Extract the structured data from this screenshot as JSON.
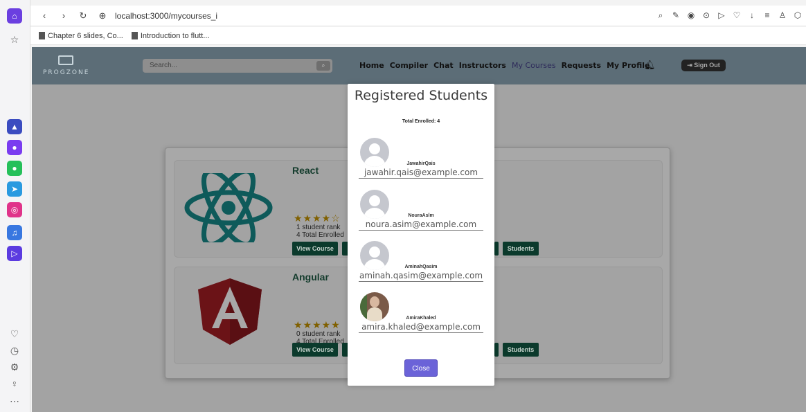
{
  "browser": {
    "url": "localhost:3000/mycourses_i",
    "bookmarks": [
      "Chapter 6 slides, Co...",
      "Introduction to flutt..."
    ]
  },
  "navbar": {
    "logo_text": "PROGZONE",
    "search_placeholder": "Search...",
    "links": [
      "Home",
      "Compiler",
      "Chat",
      "Instructors",
      "My Courses",
      "Requests",
      "My Profile"
    ],
    "active_link": "My Courses",
    "signout_label": "Sign Out"
  },
  "courses": [
    {
      "title": "React",
      "rating_stars": 4,
      "student_rank": "1 student rank",
      "enrolled": "4 Total Enrolled",
      "view_label": "View Course",
      "students_label": "Students"
    },
    {
      "title": "Angular",
      "rating_stars": 5,
      "student_rank": "0 student rank",
      "enrolled": "4 Total Enrolled",
      "view_label": "View Course",
      "students_label": "Students"
    }
  ],
  "modal": {
    "title": "Registered Students",
    "total_enrolled": "Total Enrolled: 4",
    "students": [
      {
        "name": "JawahirQais",
        "email": "jawahir.qais@example.com",
        "avatar": "placeholder"
      },
      {
        "name": "NouraAslm",
        "email": "noura.asim@example.com",
        "avatar": "placeholder"
      },
      {
        "name": "AminahQasim",
        "email": "aminah.qasim@example.com",
        "avatar": "placeholder"
      },
      {
        "name": "AmiraKhaled",
        "email": "amira.khaled@example.com",
        "avatar": "photo"
      }
    ],
    "close_label": "Close"
  },
  "colors": {
    "navbar": "#5c6d77",
    "overlay_page": "#a3a3a3",
    "course_button": "#0b3a2c",
    "close_button": "#6b63d8"
  }
}
